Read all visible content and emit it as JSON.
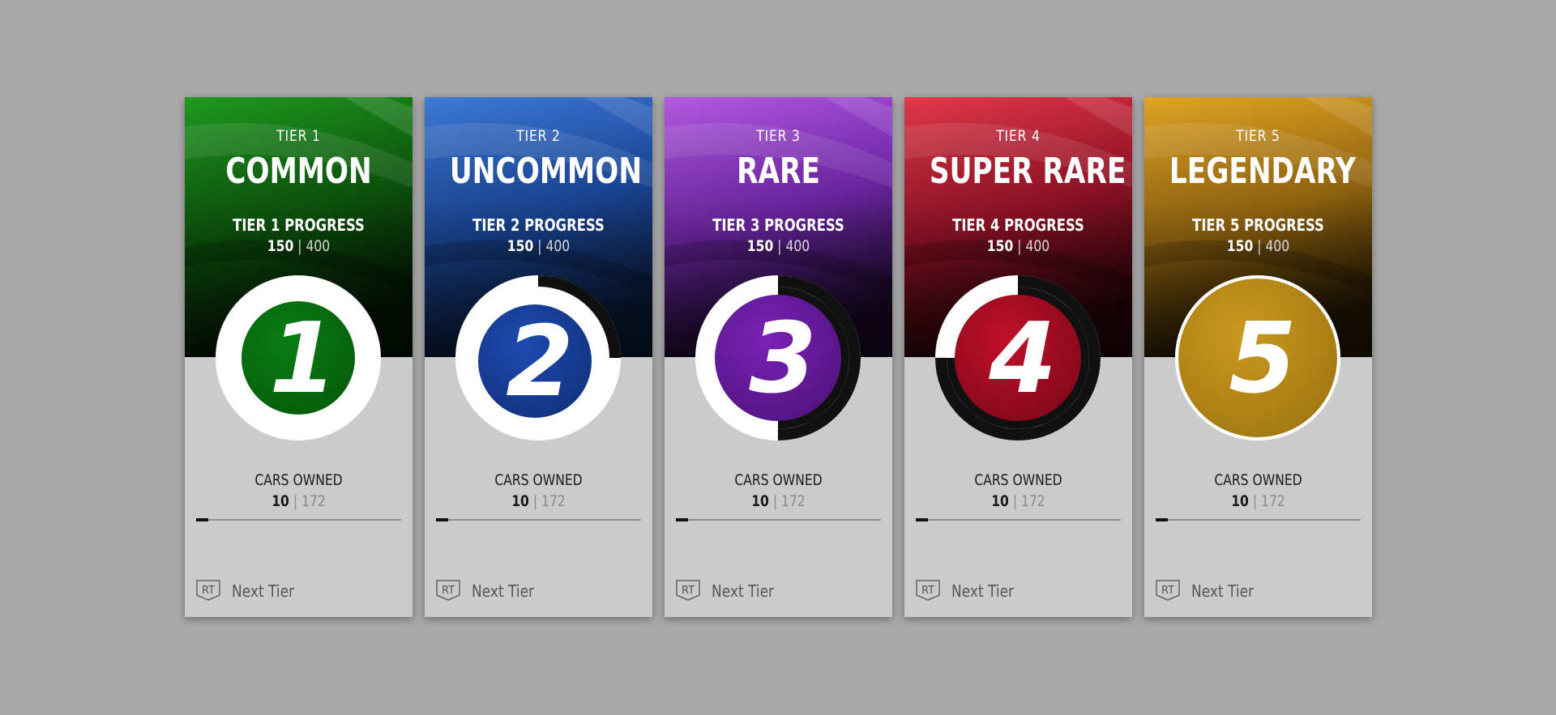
{
  "cards": [
    {
      "tier_label": "TIER 1",
      "tier_name": "COMMON",
      "progress_label": "TIER 1 PROGRESS",
      "progress_current": "150",
      "progress_total": "400",
      "progress_fraction": 0,
      "ring_arc_fraction": 0,
      "badge_digit": "1",
      "cars_owned_label": "CARS OWNED",
      "cars_owned_current": "10",
      "cars_owned_total": "172",
      "cars_owned_fraction": 0.058,
      "next_tier_button": "RT",
      "next_tier_label": "Next Tier",
      "colors": {
        "bg_top": "#1f9a1f",
        "bg_mid": "#0e5f0e",
        "bg_bottom": "#041804",
        "badge": "#0a7d14",
        "badge_dark": "#045a0a"
      }
    },
    {
      "tier_label": "TIER 2",
      "tier_name": "UNCOMMON",
      "progress_label": "TIER 2 PROGRESS",
      "progress_current": "150",
      "progress_total": "400",
      "ring_arc_fraction": 0.25,
      "badge_digit": "2",
      "cars_owned_label": "CARS OWNED",
      "cars_owned_current": "10",
      "cars_owned_total": "172",
      "cars_owned_fraction": 0.058,
      "next_tier_button": "RT",
      "next_tier_label": "Next Tier",
      "colors": {
        "bg_top": "#3f7ad6",
        "bg_mid": "#1d4ea8",
        "bg_bottom": "#0b1e40",
        "badge": "#1e4bb0",
        "badge_dark": "#10307a"
      }
    },
    {
      "tier_label": "TIER 3",
      "tier_name": "RARE",
      "progress_label": "TIER 3 PROGRESS",
      "progress_current": "150",
      "progress_total": "400",
      "ring_arc_fraction": 0.5,
      "badge_digit": "3",
      "cars_owned_label": "CARS OWNED",
      "cars_owned_current": "10",
      "cars_owned_total": "172",
      "cars_owned_fraction": 0.058,
      "next_tier_button": "RT",
      "next_tier_label": "Next Tier",
      "colors": {
        "bg_top": "#b45ae0",
        "bg_mid": "#7a2ab8",
        "bg_bottom": "#1c0a2c",
        "badge": "#7b22b8",
        "badge_dark": "#4e127a"
      }
    },
    {
      "tier_label": "TIER 4",
      "tier_name": "SUPER RARE",
      "progress_label": "TIER 4 PROGRESS",
      "progress_current": "150",
      "progress_total": "400",
      "ring_arc_fraction": 0.75,
      "badge_digit": "4",
      "cars_owned_label": "CARS OWNED",
      "cars_owned_current": "10",
      "cars_owned_total": "172",
      "cars_owned_fraction": 0.058,
      "next_tier_button": "RT",
      "next_tier_label": "Next Tier",
      "colors": {
        "bg_top": "#e23a4a",
        "bg_mid": "#a3142a",
        "bg_bottom": "#2a040c",
        "badge": "#c1102a",
        "badge_dark": "#7c0818"
      }
    },
    {
      "tier_label": "TIER 5",
      "tier_name": "LEGENDARY",
      "progress_label": "TIER 5 PROGRESS",
      "progress_current": "150",
      "progress_total": "400",
      "ring_arc_fraction": 0,
      "badge_digit": "5",
      "cars_owned_label": "CARS OWNED",
      "cars_owned_current": "10",
      "cars_owned_total": "172",
      "cars_owned_fraction": 0.058,
      "next_tier_button": "RT",
      "next_tier_label": "Next Tier",
      "colors": {
        "bg_top": "#e0a524",
        "bg_mid": "#a87412",
        "bg_bottom": "#2a1c04",
        "badge": "#c9991f",
        "badge_dark": "#9e7410"
      }
    }
  ]
}
